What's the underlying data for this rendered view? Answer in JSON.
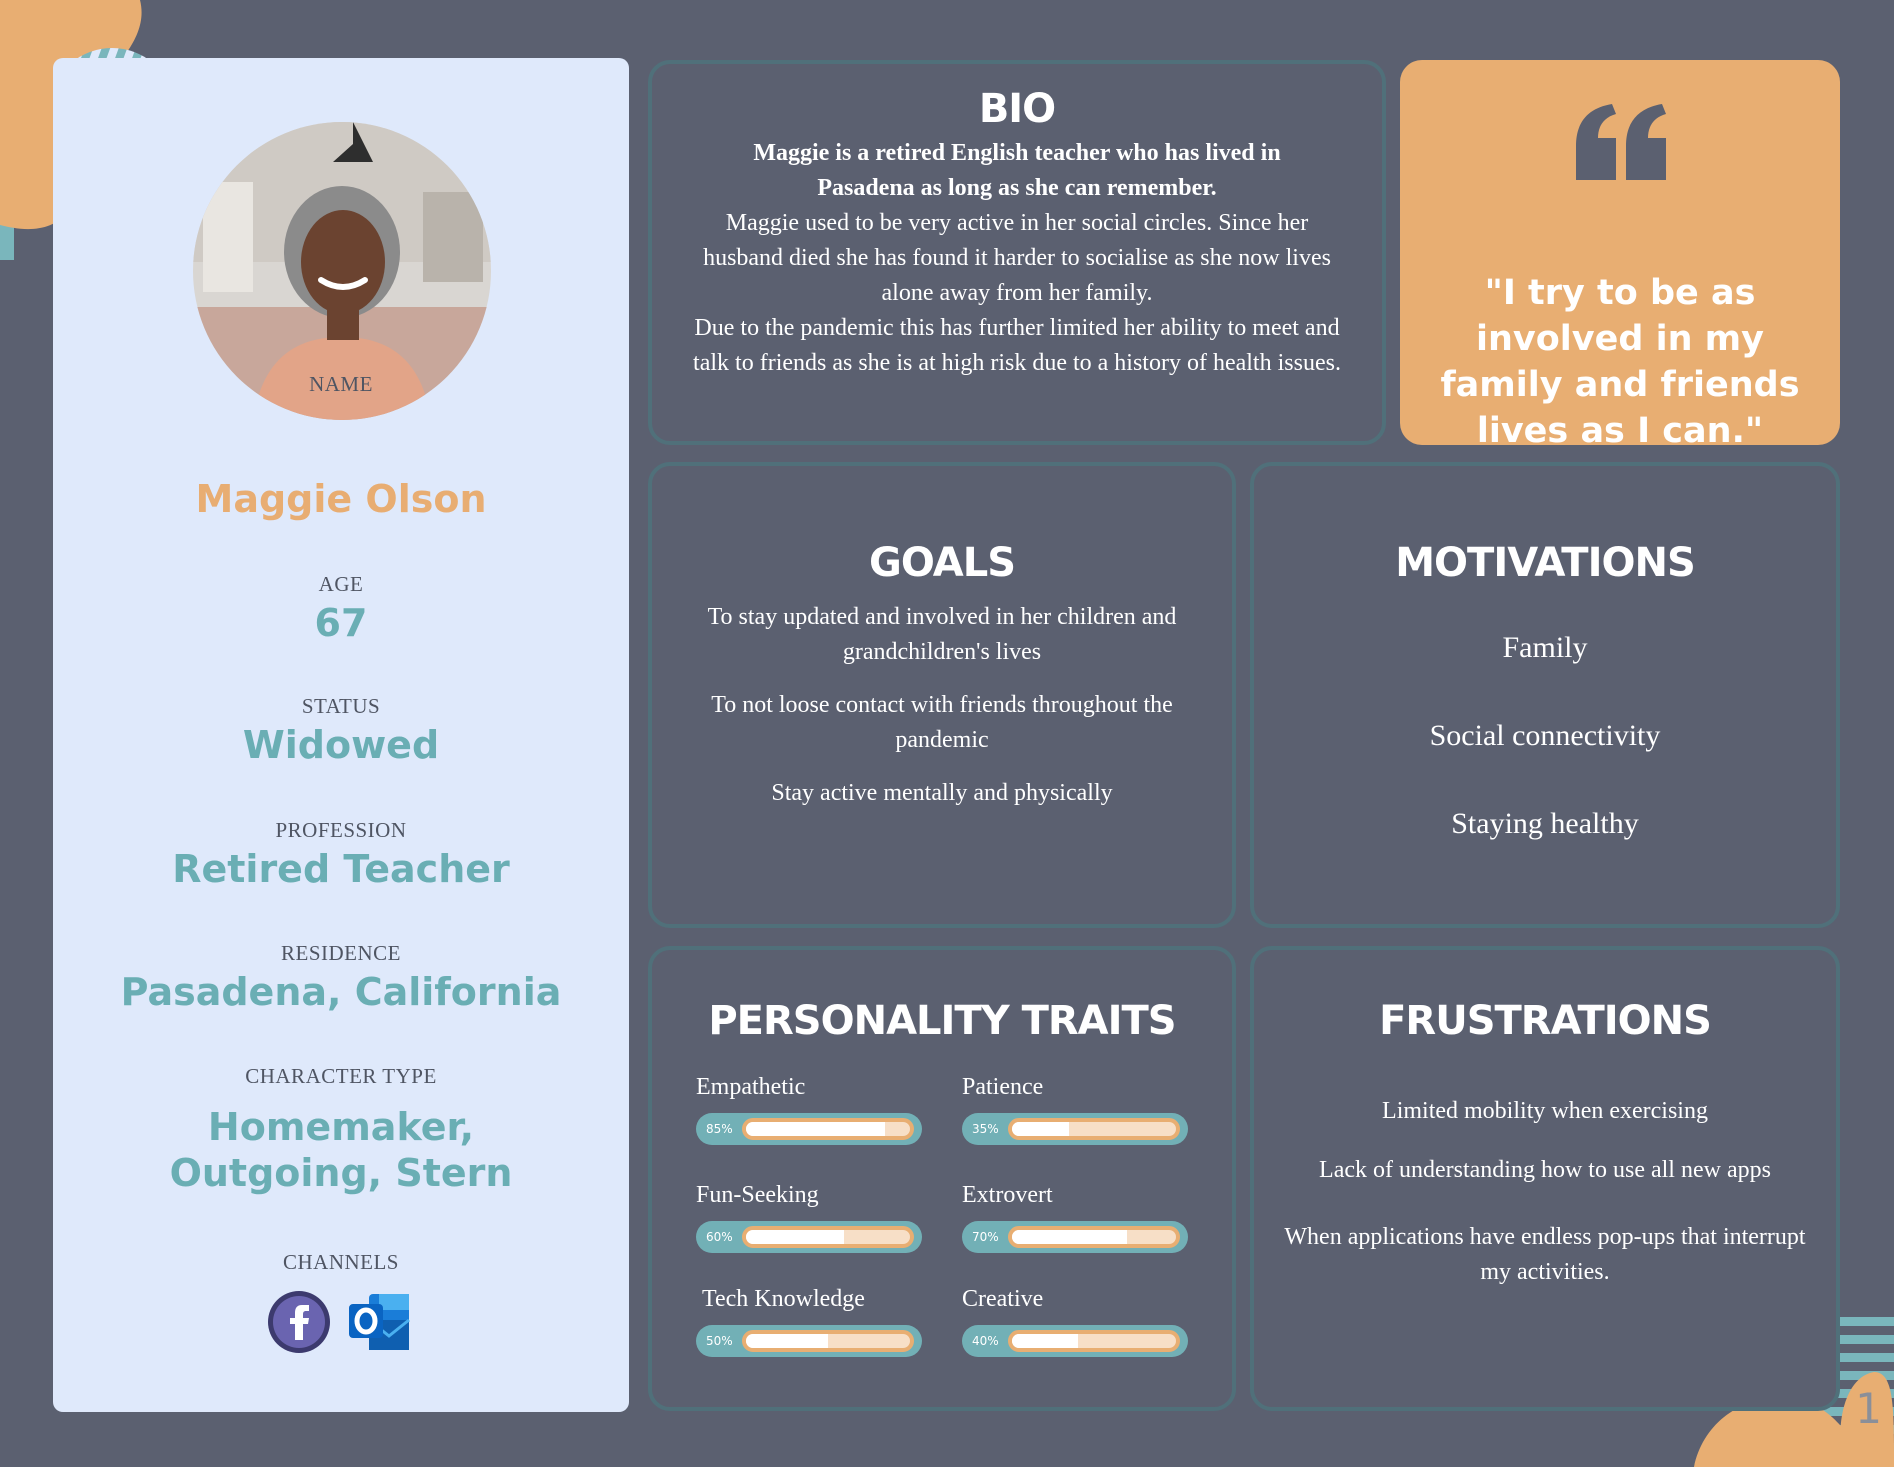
{
  "profile": {
    "name_label": "NAME",
    "name": "Maggie Olson",
    "age_label": "AGE",
    "age": "67",
    "status_label": "STATUS",
    "status": "Widowed",
    "profession_label": "PROFESSION",
    "profession": "Retired Teacher",
    "residence_label": "RESIDENCE",
    "residence": "Pasadena, California",
    "character_label": "CHARACTER  TYPE",
    "character_line1": "Homemaker,",
    "character_line2": "Outgoing, Stern",
    "channels_label": "CHANNELS",
    "channels": [
      "facebook-icon",
      "outlook-icon"
    ]
  },
  "bio": {
    "title": "BIO",
    "lead": "Maggie is a retired English teacher who has lived in Pasadena as long as she can remember.",
    "body1": "Maggie used to be very active in her social circles. Since her husband died she has found it harder to socialise as she now lives alone away from her family.",
    "body2": "Due to the pandemic this has further limited her ability to meet and talk to friends as she is at high risk due to a history of health issues."
  },
  "quote": {
    "text": "\"I try to be as involved in my family and friends lives as I can.\""
  },
  "goals": {
    "title": "GOALS",
    "items": [
      "To stay updated and involved in her children and grandchildren's  lives",
      "To not loose contact with friends throughout the pandemic",
      "Stay active mentally and physically"
    ]
  },
  "motivations": {
    "title": "MOTIVATIONS",
    "items": [
      "Family",
      "Social connectivity",
      "Staying healthy"
    ]
  },
  "personality": {
    "title": "PERSONALITY TRAITS",
    "traits": [
      {
        "label": "Empathetic",
        "pct_label": "85%",
        "value": 0.85
      },
      {
        "label": "Patience",
        "pct_label": "35%",
        "value": 0.35
      },
      {
        "label": "Fun-Seeking",
        "pct_label": "60%",
        "value": 0.6
      },
      {
        "label": "Extrovert",
        "pct_label": "70%",
        "value": 0.7
      },
      {
        "label": "Tech Knowledge",
        "pct_label": "50%",
        "value": 0.5
      },
      {
        "label": "Creative",
        "pct_label": "40%",
        "value": 0.4
      }
    ]
  },
  "frustrations": {
    "title": "FRUSTRATIONS",
    "items": [
      "Limited mobility when exercising",
      "Lack of understanding how to use all new apps",
      "When applications have endless pop-ups that interrupt my activities."
    ]
  },
  "page_number": "1",
  "colors": {
    "background": "#5b6070",
    "profile_panel": "#dfe9fb",
    "accent_orange": "#e8ae72",
    "accent_teal": "#6aaeb4"
  }
}
